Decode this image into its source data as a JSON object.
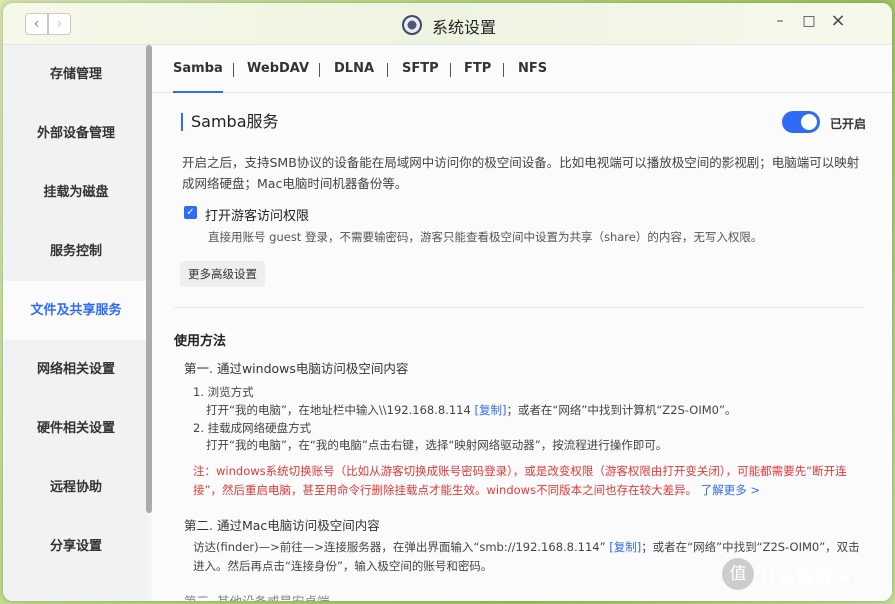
{
  "window": {
    "title": "系统设置",
    "back": "‹",
    "forward": "›",
    "minimize": "–",
    "maximize": "□",
    "close": "×"
  },
  "sidebar": {
    "items": [
      {
        "label": "存储管理"
      },
      {
        "label": "外部设备管理"
      },
      {
        "label": "挂载为磁盘"
      },
      {
        "label": "服务控制"
      },
      {
        "label": "文件及共享服务",
        "active": true
      },
      {
        "label": "网络相关设置"
      },
      {
        "label": "硬件相关设置"
      },
      {
        "label": "远程协助"
      },
      {
        "label": "分享设置"
      }
    ]
  },
  "tabs": [
    "Samba",
    "WebDAV",
    "DLNA",
    "SFTP",
    "FTP",
    "NFS"
  ],
  "samba": {
    "title": "Samba服务",
    "toggle_label": "已开启",
    "toggle_on": true,
    "desc": "开启之后，支持SMB协议的设备能在局域网中访问你的极空间设备。比如电视端可以播放极空间的影视剧；电脑端可以映射成网络硬盘；Mac电脑时间机器备份等。",
    "guest_label": "打开游客访问权限",
    "guest_checked": true,
    "guest_desc": "直接用账号 guest 登录，不需要输密码，游客只能查看极空间中设置为共享（share）的内容，无写入权限。",
    "advanced_btn": "更多高级设置"
  },
  "usage": {
    "title": "使用方法",
    "step1_title": "第一. 通过windows电脑访问极空间内容",
    "step1_item1_title": "1. 浏览方式",
    "step1_item1_text": "打开“我的电脑”，在地址栏中输入\\\\192.168.8.114",
    "copy_label": "[复制]",
    "step1_item1_tail": "；或者在“网络”中找到计算机“Z2S-OIM0”。",
    "step1_item2_title": "2. 挂载成网络硬盘方式",
    "step1_item2_text": "打开“我的电脑”，在“我的电脑”点击右键，选择“映射网络驱动器”，按流程进行操作即可。",
    "warning": "注：windows系统切换账号（比如从游客切换成账号密码登录），或是改变权限（游客权限由打开变关闭），可能都需要先“断开连接”，然后重启电脑，甚至用命令行删除挂载点才能生效。windows不同版本之间也存在较大差异。",
    "learn_more": "了解更多 >",
    "step2_title": "第二. 通过Mac电脑访问极空间内容",
    "step2_text": "访达(finder)—>前往—>连接服务器，在弹出界面输入“smb://192.168.8.114”",
    "step2_copy": "[复制]",
    "step2_tail": "；或者在“网络”中找到“Z2S-OIM0”，双击进入。然后再点击“连接身份”，输入极空间的账号和密码。",
    "step3_cut": "第三. 其他设备或是安卓端"
  },
  "watermark": {
    "icon": "值",
    "text": "什么值得买"
  }
}
